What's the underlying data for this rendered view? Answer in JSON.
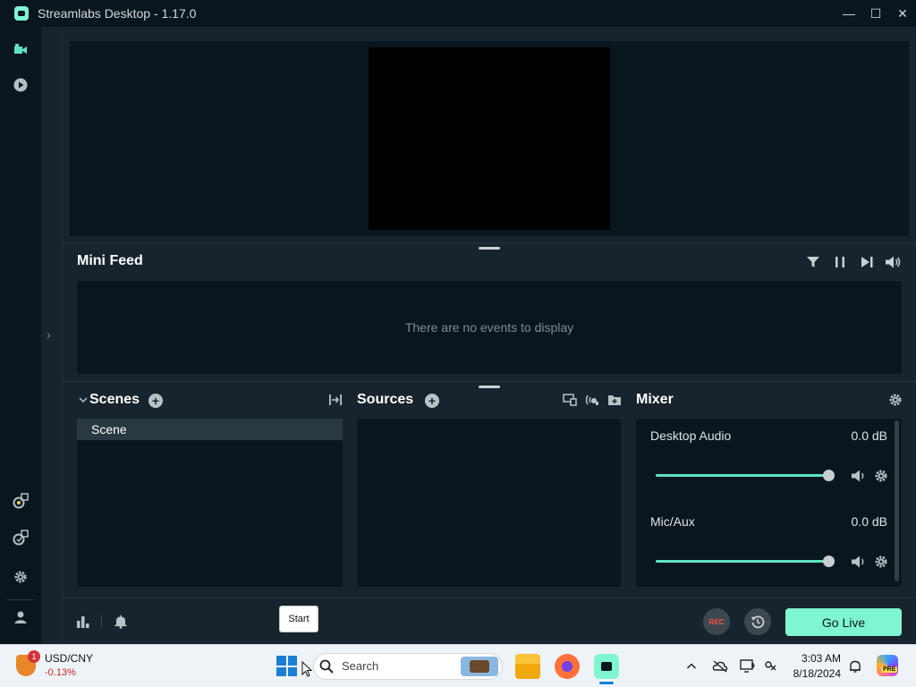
{
  "window": {
    "title": "Streamlabs Desktop - 1.17.0",
    "minimize_glyph": "—",
    "maximize_glyph": "☐",
    "close_glyph": "✕"
  },
  "leftnav": {
    "items": [
      {
        "name": "editor-icon"
      },
      {
        "name": "playback-icon"
      },
      {
        "name": "studio-mode-icon"
      },
      {
        "name": "layout-editor-icon"
      },
      {
        "name": "settings-icon"
      },
      {
        "name": "user-icon"
      }
    ],
    "collapse_glyph": "›"
  },
  "minifeed": {
    "title": "Mini Feed",
    "empty_text": "There are no events to display",
    "icons": [
      "filter-icon",
      "pause-icon",
      "skip-icon",
      "volume-icon"
    ]
  },
  "scenes": {
    "title": "Scenes",
    "items": [
      {
        "label": "Scene"
      }
    ]
  },
  "sources": {
    "title": "Sources"
  },
  "mixer": {
    "title": "Mixer",
    "channels": [
      {
        "label": "Desktop Audio",
        "db": "0.0 dB",
        "level": 1.0
      },
      {
        "label": "Mic/Aux",
        "db": "0.0 dB",
        "level": 1.0
      }
    ]
  },
  "bottombar": {
    "rec_label": "REC",
    "golive_label": "Go Live",
    "tooltip": "Start"
  },
  "taskbar": {
    "ticker_symbol": "USD/CNY",
    "ticker_change": "-0.13%",
    "badge_count": "1",
    "search_placeholder": "Search",
    "time": "3:03 AM",
    "date": "8/18/2024",
    "pre_tag": "PRE"
  },
  "colors": {
    "accent": "#80f5d2",
    "background": "#17242d",
    "panel": "#0a161d"
  }
}
